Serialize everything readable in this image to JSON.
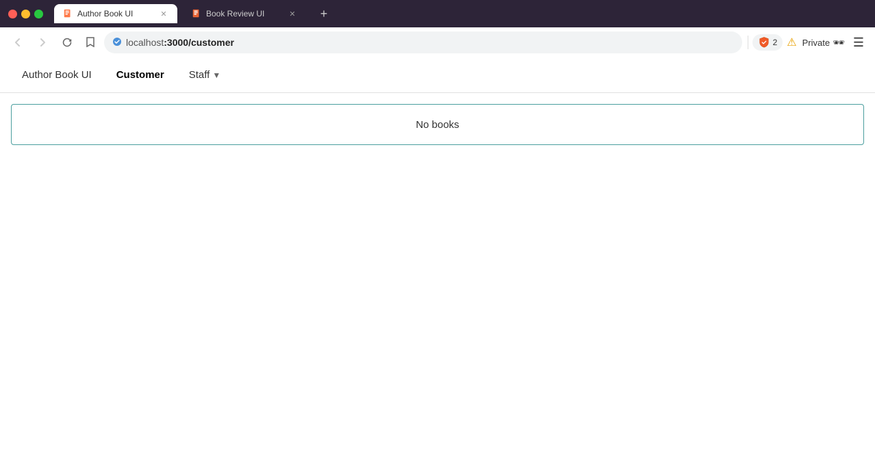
{
  "browser": {
    "tabs": [
      {
        "id": "tab-1",
        "title": "Author Book UI",
        "favicon": "book-icon",
        "active": true,
        "url": "localhost:3000/customer"
      },
      {
        "id": "tab-2",
        "title": "Book Review UI",
        "favicon": "book-icon",
        "active": false,
        "url": ""
      }
    ],
    "address": {
      "protocol": "localhost",
      "domain": ":3000",
      "path": "/customer",
      "full": "localhost:3000/customer"
    },
    "new_tab_label": "+",
    "back_disabled": true,
    "forward_disabled": true,
    "private_label": "Private",
    "extensions": {
      "brave_count": "2"
    }
  },
  "app": {
    "nav": {
      "items": [
        {
          "id": "author-book-ui",
          "label": "Author Book UI",
          "active": false,
          "has_dropdown": false
        },
        {
          "id": "customer",
          "label": "Customer",
          "active": true,
          "has_dropdown": false
        },
        {
          "id": "staff",
          "label": "Staff",
          "active": false,
          "has_dropdown": true
        }
      ]
    },
    "main": {
      "no_books_label": "No books"
    }
  }
}
